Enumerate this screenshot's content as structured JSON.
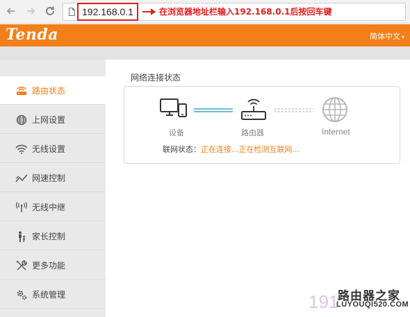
{
  "browser": {
    "url": "192.168.0.1",
    "annotation": "在浏览器地址栏输入192.168.0.1后按回车键"
  },
  "header": {
    "logo": "Tenda",
    "language": "简体中文",
    "brand_color": "#f27f1a"
  },
  "sidebar": {
    "items": [
      {
        "label": "路由状态",
        "icon": "router-status-icon",
        "active": true
      },
      {
        "label": "上网设置",
        "icon": "globe-icon"
      },
      {
        "label": "无线设置",
        "icon": "wifi-icon"
      },
      {
        "label": "网速控制",
        "icon": "speed-control-icon"
      },
      {
        "label": "无线中继",
        "icon": "antenna-icon"
      },
      {
        "label": "家长控制",
        "icon": "parent-child-icon"
      },
      {
        "label": "更多功能",
        "icon": "tools-icon"
      },
      {
        "label": "系统管理",
        "icon": "gears-icon"
      }
    ]
  },
  "main": {
    "section_title": "网络连接状态",
    "devices": {
      "device": "设备",
      "router": "路由器",
      "internet": "Internet"
    },
    "status": {
      "label": "联网状态：",
      "text1": "正在连接...",
      "text2": "正在检测互联网..."
    }
  },
  "watermark": {
    "name": "路由器之家",
    "url": "LUYOUQI520.COM",
    "number": "191"
  }
}
